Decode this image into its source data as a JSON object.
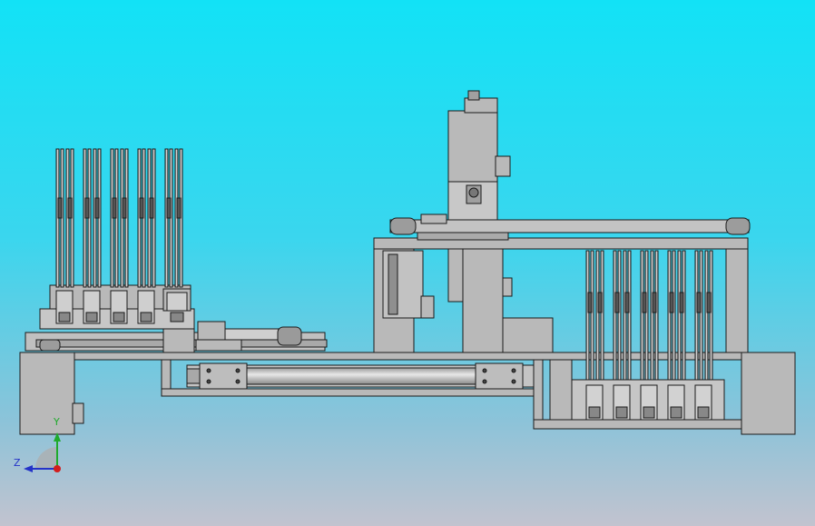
{
  "viewport": {
    "background_top": "#12e2f6",
    "background_bottom": "#c2c3cf",
    "part_fill": "#b9b9b9",
    "part_stroke": "#1a1a1a"
  },
  "triad": {
    "y_label": "Y",
    "z_label": "Z",
    "y_color": "#1faa2c",
    "z_color": "#2433c8",
    "x_color": "#d21d1d"
  }
}
